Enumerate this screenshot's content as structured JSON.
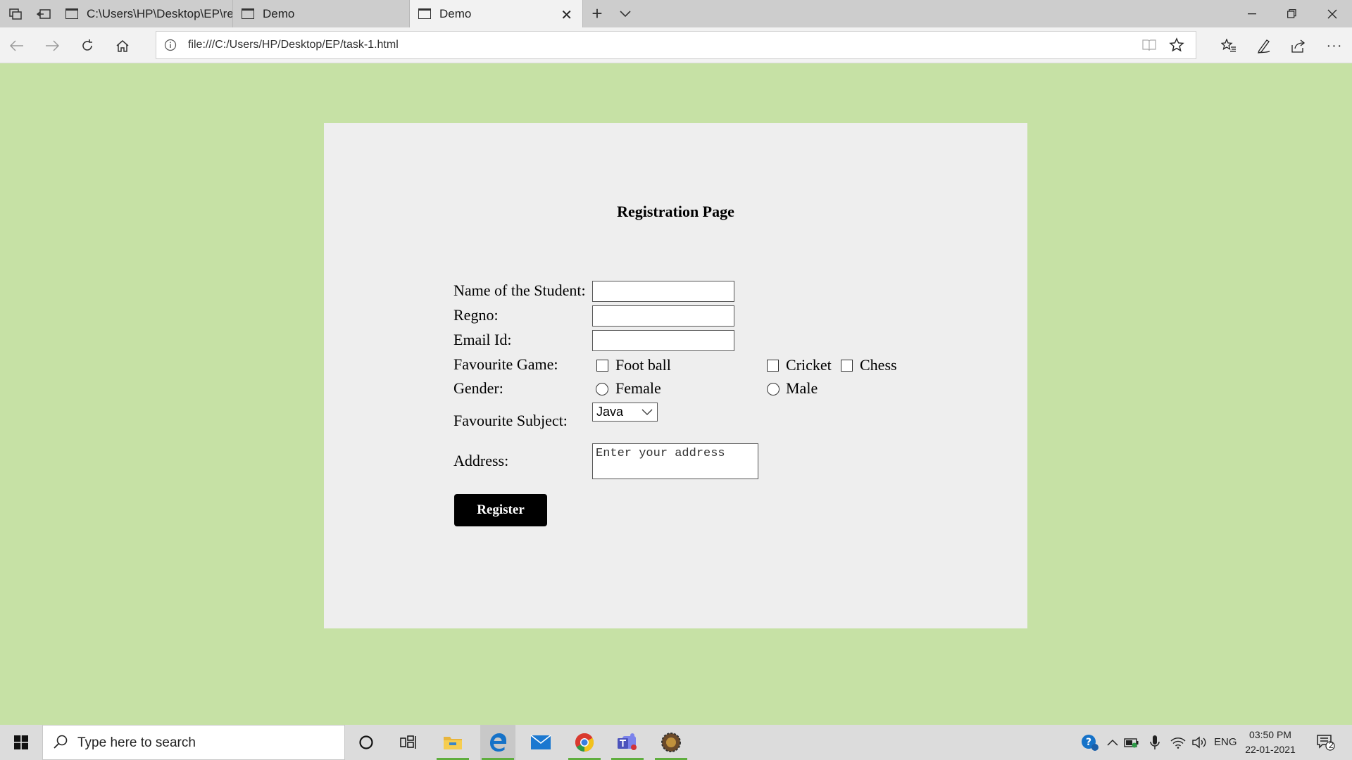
{
  "browser": {
    "tabs": [
      {
        "title": "C:\\Users\\HP\\Desktop\\EP\\reg",
        "active": false
      },
      {
        "title": "Demo",
        "active": false
      },
      {
        "title": "Demo",
        "active": true
      }
    ],
    "url": "file:///C:/Users/HP/Desktop/EP/task-1.html",
    "icons": [
      "tab-manager-icon",
      "set-aside-icon",
      "back-icon",
      "forward-icon",
      "refresh-icon",
      "home-icon",
      "site-info-icon",
      "reading-view-icon",
      "favorite-star-icon",
      "favorites-list-icon",
      "pen-icon",
      "share-icon",
      "more-icon"
    ]
  },
  "form": {
    "heading": "Registration Page",
    "name_label": "Name of the Student:",
    "regno_label": "Regno:",
    "email_label": "Email Id:",
    "game_label": "Favourite Game:",
    "games": [
      "Foot ball",
      "Cricket",
      "Chess"
    ],
    "gender_label": "Gender:",
    "genders": [
      "Female",
      "Male"
    ],
    "subject_label": "Favourite Subject:",
    "subject_selected": "Java",
    "address_label": "Address:",
    "address_placeholder": "Enter your address",
    "register_label": "Register"
  },
  "colors": {
    "page_background": "#c6e1a5",
    "card_background": "#eeeeee",
    "button_background": "#000000",
    "button_text": "#ffffff"
  },
  "taskbar": {
    "search_placeholder": "Type here to search",
    "language": "ENG",
    "time": "03:50 PM",
    "date": "22-01-2021",
    "notification_count": "2"
  }
}
